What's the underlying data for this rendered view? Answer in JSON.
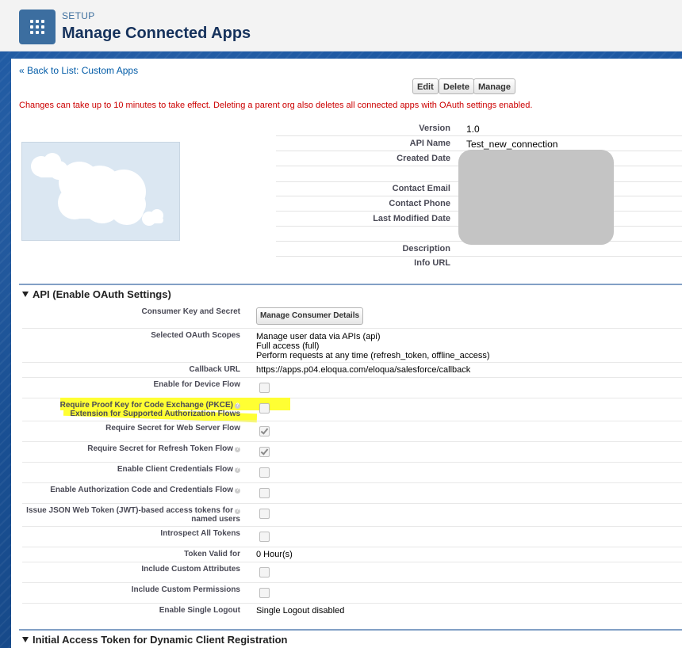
{
  "header": {
    "eyebrow": "SETUP",
    "title": "Manage Connected Apps"
  },
  "nav": {
    "back_link": "« Back to List: Custom Apps"
  },
  "actions": {
    "edit": "Edit",
    "delete": "Delete",
    "manage": "Manage"
  },
  "notice": "Changes can take up to 10 minutes to take effect. Deleting a parent org also deletes all connected apps with OAuth settings enabled.",
  "info": {
    "version_label": "Version",
    "version_value": "1.0",
    "api_name_label": "API Name",
    "api_name_value": "Test_new_connection",
    "created_date_label": "Created Date",
    "contact_email_label": "Contact Email",
    "contact_phone_label": "Contact Phone",
    "last_modified_label": "Last Modified Date",
    "description_label": "Description",
    "info_url_label": "Info URL"
  },
  "api_section": {
    "title": "API (Enable OAuth Settings)",
    "consumer_key_label": "Consumer Key and Secret",
    "manage_consumer_button": "Manage Consumer Details",
    "scopes_label": "Selected OAuth Scopes",
    "scopes": [
      "Manage user data via APIs (api)",
      "Full access (full)",
      "Perform requests at any time (refresh_token, offline_access)"
    ],
    "callback_label": "Callback URL",
    "callback_value": "https://apps.p04.eloqua.com/eloqua/salesforce/callback",
    "device_flow_label": "Enable for Device Flow",
    "pkce_label_1": "Require Proof Key for Code Exchange (PKCE)",
    "pkce_label_2": "Extension for Supported Authorization Flows",
    "secret_web_label": "Require Secret for Web Server Flow",
    "secret_refresh_label": "Require Secret for Refresh Token Flow",
    "client_cred_label": "Enable Client Credentials Flow",
    "auth_code_cred_label": "Enable Authorization Code and Credentials Flow",
    "jwt_label_1": "Issue JSON Web Token (JWT)-based access tokens for",
    "jwt_label_2": "named users",
    "introspect_label": "Introspect All Tokens",
    "token_valid_label": "Token Valid for",
    "token_valid_value": "0 Hour(s)",
    "custom_attrs_label": "Include Custom Attributes",
    "custom_perms_label": "Include Custom Permissions",
    "single_logout_label": "Enable Single Logout",
    "single_logout_value": "Single Logout disabled"
  },
  "initial_section": {
    "title": "Initial Access Token for Dynamic Client Registration"
  },
  "colors": {
    "highlight": "#ffff33",
    "notice_red": "#cc0000",
    "link_blue": "#015ba7",
    "header_blue": "#16325c"
  }
}
